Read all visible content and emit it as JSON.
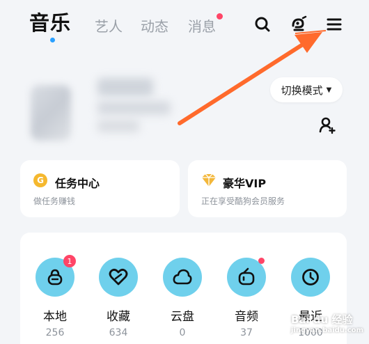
{
  "nav": {
    "tabs": [
      {
        "label": "音乐",
        "active": true
      },
      {
        "label": "艺人"
      },
      {
        "label": "动态"
      },
      {
        "label": "消息",
        "has_dot": true
      }
    ],
    "icons": [
      "search-icon",
      "voice-assistant-icon",
      "menu-icon"
    ]
  },
  "profile": {
    "mode_button": "切换模式",
    "add_friend_icon": "add-user-icon"
  },
  "cards": {
    "task": {
      "title": "任务中心",
      "subtitle": "做任务赚钱",
      "icon": "coin-icon"
    },
    "vip": {
      "title": "豪华VIP",
      "subtitle": "正在享受酷狗会员服务",
      "icon": "diamond-icon"
    }
  },
  "quick_access": [
    {
      "label": "本地",
      "count": "256",
      "icon": "local-music-icon",
      "badge": "1"
    },
    {
      "label": "收藏",
      "count": "634",
      "icon": "heart-icon"
    },
    {
      "label": "云盘",
      "count": "0",
      "icon": "cloud-icon"
    },
    {
      "label": "音频",
      "count": "37",
      "icon": "audio-icon",
      "dot": true
    },
    {
      "label": "最近",
      "count": "1000",
      "icon": "clock-icon"
    }
  ],
  "watermark": {
    "text": "Bai du 经验",
    "sub": "jingyan.baidu.com"
  },
  "colors": {
    "accent_blue": "#2aa0ff",
    "badge_red": "#ff4567",
    "icon_circle": "#6fd0ec",
    "annotation_arrow": "#ff6a2c",
    "coin": "#f5b82e",
    "vip_gold": "#f3b73a"
  }
}
